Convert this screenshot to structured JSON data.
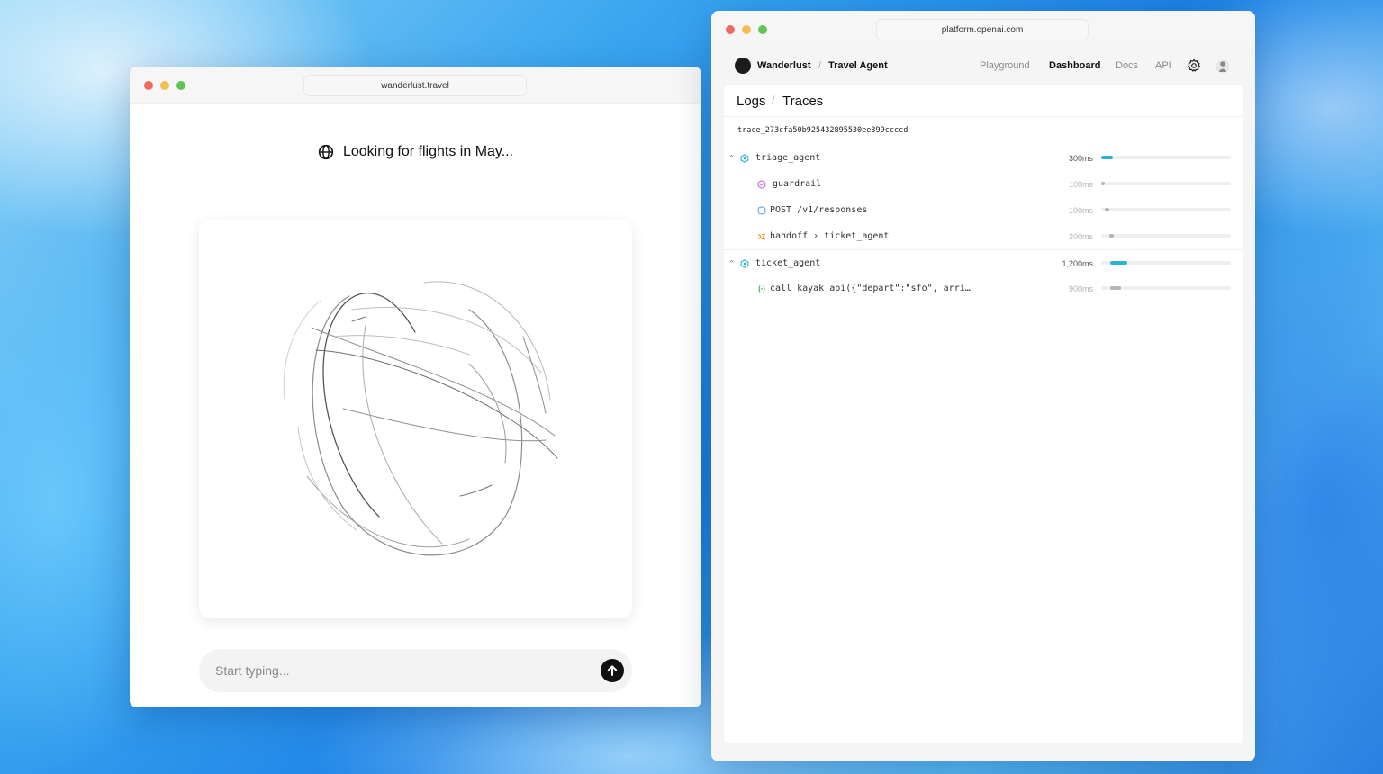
{
  "left_window": {
    "url": "wanderlust.travel",
    "status_text": "Looking for flights in May...",
    "status_icon": "globe-icon",
    "composer": {
      "placeholder": "Start typing...",
      "send_icon": "arrow-up-icon"
    }
  },
  "right_window": {
    "url": "platform.openai.com",
    "org_name": "Wanderlust",
    "crumb_sep": "/",
    "project_name": "Travel Agent",
    "nav_links": [
      "Playground",
      "Dashboard",
      "Docs",
      "API"
    ],
    "active_nav": "Dashboard",
    "breadcrumb": {
      "logs": "Logs",
      "sep": "/",
      "traces": "Traces"
    },
    "trace_id": "trace_273cfa50b925432895530ee399ccccd",
    "spans": [
      {
        "label": "triage_agent",
        "duration": "300ms",
        "level": 0,
        "icon": "agent-icon",
        "offset": 0.0,
        "length": 0.09,
        "color": "#2bb3d6"
      },
      {
        "label": "guardrail",
        "duration": "100ms",
        "level": 1,
        "icon": "guardrail-icon",
        "offset": 0.0,
        "length": 0.03,
        "color": "#b5b5b5"
      },
      {
        "label": "POST /v1/responses",
        "duration": "100ms",
        "level": 1,
        "icon": "response-icon",
        "offset": 0.03,
        "length": 0.03,
        "color": "#b5b5b5"
      },
      {
        "label": "handoff › ticket_agent",
        "duration": "200ms",
        "level": 1,
        "icon": "handoff-icon",
        "offset": 0.06,
        "length": 0.04,
        "color": "#b5b5b5"
      },
      {
        "label": "ticket_agent",
        "duration": "1,200ms",
        "level": 0,
        "icon": "agent-icon",
        "offset": 0.07,
        "length": 0.13,
        "color": "#2bb3d6"
      },
      {
        "label": "call_kayak_api({\"depart\":\"sfo\", arri…",
        "duration": "900ms",
        "level": 1,
        "icon": "function-icon",
        "offset": 0.07,
        "length": 0.08,
        "color": "#b5b5b5"
      }
    ],
    "colors": {
      "accent": "#2bb3d6",
      "traffic_red": "#ee6a5f",
      "traffic_yellow": "#f5bd4f",
      "traffic_green": "#61c454"
    }
  }
}
